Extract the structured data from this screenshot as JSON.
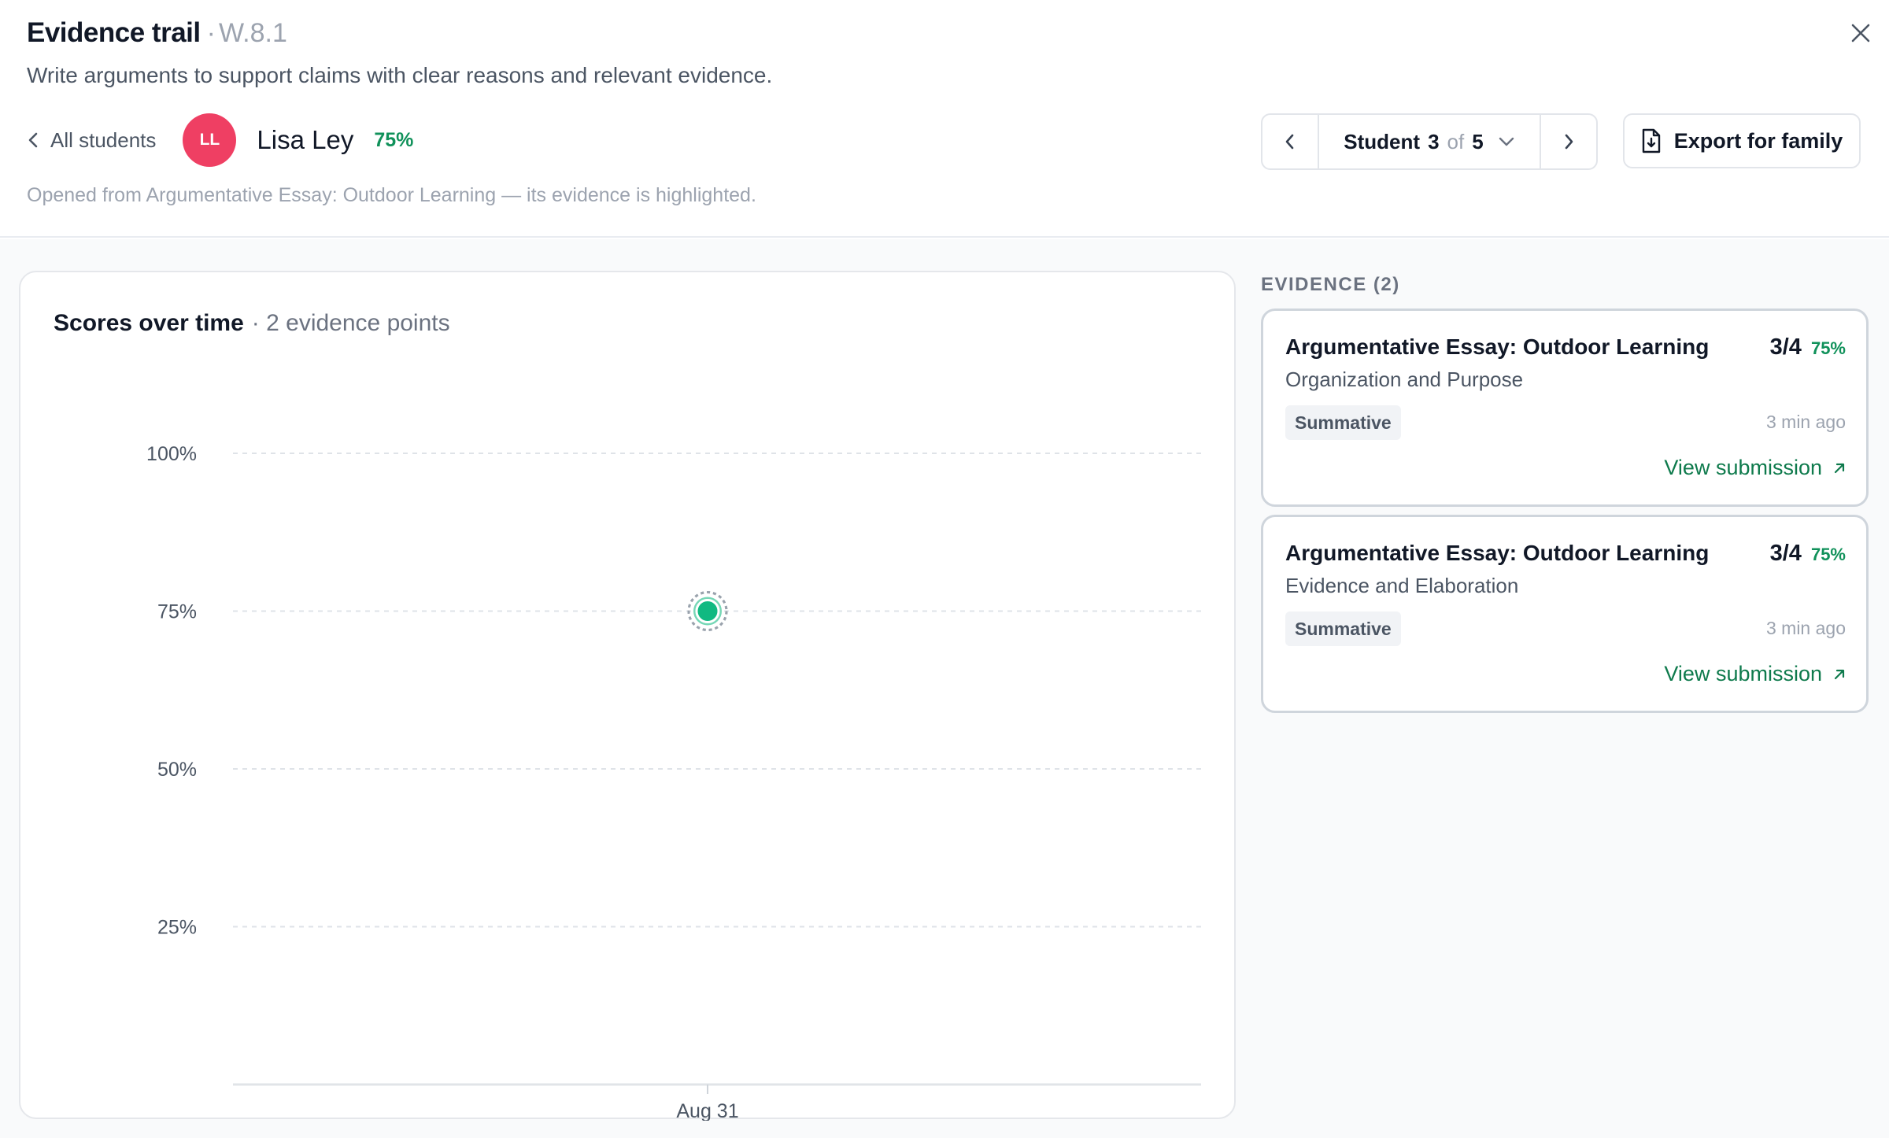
{
  "header": {
    "title": "Evidence trail",
    "separator": "·",
    "standard_code": "W.8.1",
    "description": "Write arguments to support claims with clear reasons and relevant evidence.",
    "back_label": "All students",
    "opened_note": "Opened from Argumentative Essay: Outdoor Learning — its evidence is highlighted."
  },
  "student": {
    "initials": "LL",
    "name": "Lisa Ley",
    "score": "75%",
    "avatar_color": "#ef3f63"
  },
  "navigator": {
    "label": "Student",
    "current": "3",
    "of_label": "of",
    "total": "5"
  },
  "export": {
    "label": "Export for family"
  },
  "chart": {
    "title": "Scores over time",
    "subtitle": "· 2 evidence points"
  },
  "chart_data": {
    "type": "scatter",
    "title": "Scores over time",
    "y_ticks": [
      "100%",
      "75%",
      "50%",
      "25%"
    ],
    "x_ticks": [
      "Aug 31"
    ],
    "ylim": [
      0,
      100
    ],
    "grid": true,
    "series": [
      {
        "x": [
          "Aug 31",
          "Aug 31"
        ],
        "y": [
          75,
          75
        ]
      }
    ],
    "point_color": "#10b981"
  },
  "evidence": {
    "heading": "EVIDENCE (2)",
    "items": [
      {
        "title": "Argumentative Essay: Outdoor Learning",
        "criterion": "Organization and Purpose",
        "score": "3/4",
        "percent": "75%",
        "type": "Summative",
        "time": "3 min ago",
        "link_label": "View submission"
      },
      {
        "title": "Argumentative Essay: Outdoor Learning",
        "criterion": "Evidence and Elaboration",
        "score": "3/4",
        "percent": "75%",
        "type": "Summative",
        "time": "3 min ago",
        "link_label": "View submission"
      }
    ]
  },
  "colors": {
    "accent_green": "#10915a",
    "link_green": "#0e7a4c",
    "muted": "#9ca3af"
  }
}
